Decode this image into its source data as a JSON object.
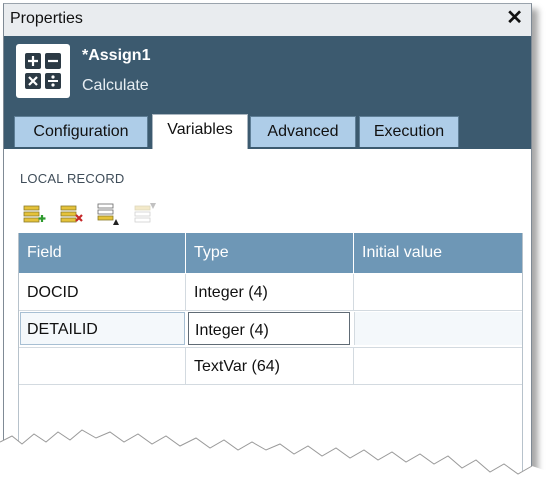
{
  "window": {
    "title": "Properties",
    "close_glyph": "✕"
  },
  "header": {
    "name": "*Assign1",
    "subtitle": "Calculate",
    "icon": "calculator-icon"
  },
  "tabs": [
    {
      "label": "Configuration",
      "active": false
    },
    {
      "label": "Variables",
      "active": true
    },
    {
      "label": "Advanced",
      "active": false
    },
    {
      "label": "Execution",
      "active": false
    }
  ],
  "section": {
    "label": "LOCAL RECORD"
  },
  "toolbar": [
    {
      "icon": "add-field-icon",
      "enabled": true
    },
    {
      "icon": "delete-field-icon",
      "enabled": true
    },
    {
      "icon": "move-down-icon",
      "enabled": true
    },
    {
      "icon": "move-up-icon",
      "enabled": false
    }
  ],
  "grid": {
    "columns": [
      "Field",
      "Type",
      "Initial value"
    ],
    "rows": [
      {
        "field": "DOCID",
        "type": "Integer (4)",
        "initial": ""
      },
      {
        "field": "DETAILID",
        "type": "Integer (4)",
        "initial": "",
        "selected": true
      },
      {
        "field": "",
        "type": "TextVar (64)",
        "initial": ""
      }
    ]
  },
  "colors": {
    "header_bg": "#3c5a6f",
    "tab_bg": "#aecde8",
    "grid_header_bg": "#6e97b6"
  }
}
